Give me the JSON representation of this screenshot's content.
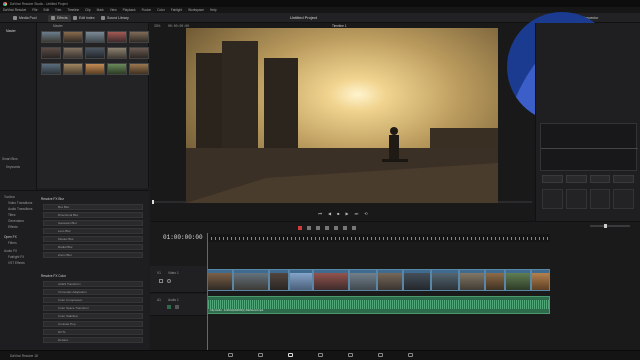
{
  "window": {
    "title": "DaVinci Resolve Studio - Untitled Project"
  },
  "menu": [
    "DaVinci Resolve",
    "File",
    "Edit",
    "Trim",
    "Timeline",
    "Clip",
    "Mark",
    "View",
    "Playback",
    "Fusion",
    "Color",
    "Fairlight",
    "Workspace",
    "Help"
  ],
  "toolbar": {
    "media_pool": "Media Pool",
    "effects": "Effects",
    "edit_index": "Edit Index",
    "sound_library": "Sound Library",
    "inspector": "Inspector",
    "project_title": "Untitled Project",
    "timeline_name": "Timeline 1",
    "zoom": "33%",
    "source_tc": "00:00:00:00"
  },
  "media": {
    "bin_label": "Master",
    "smart_bins": "Smart Bins",
    "keywords": "Keywords"
  },
  "effects": {
    "sections": [
      "Toolbox",
      "Video Transitions",
      "Audio Transitions",
      "Titles",
      "Generators",
      "Effects",
      "Open FX",
      "Filters",
      "Audio FX",
      "Fairlight FX",
      "VST Effects"
    ],
    "group1": "Resolve FX Blur",
    "group1_items": [
      "Box Blur",
      "Directional Blur",
      "Gaussian Blur",
      "Lens Blur",
      "Mosaic Blur",
      "Radial Blur",
      "Zoom Blur"
    ],
    "group2": "Resolve FX Color",
    "group2_items": [
      "ACES Transform",
      "Chromatic Adaptation",
      "Color Compressor",
      "Color Space Transform",
      "Color Stabilizer",
      "Contrast Pop",
      "DCTL",
      "Dehaze"
    ],
    "favorites": "Favorites"
  },
  "timeline": {
    "timecode": "01:00:00:00",
    "video_track": {
      "id": "V1",
      "name": "Video 1"
    },
    "audio_track": {
      "id": "A1",
      "name": "Audio 1"
    },
    "audio_clip_label": "Clip Audio - lmdSn0p0wK8h(1).RatSound.mp4"
  },
  "footer": {
    "app": "DaVinci Resolve 18"
  },
  "colors": {
    "accent": "#d23b3b",
    "video_clip": "#3f6c8e",
    "audio_clip": "#2e6a4c",
    "panel": "#1e1e20"
  },
  "icons": [
    "media-pool-icon",
    "effects-icon",
    "edit-index-icon",
    "sound-library-icon",
    "inspector-icon",
    "play-icon",
    "stop-icon",
    "loop-icon",
    "media-page-icon",
    "cut-page-icon",
    "edit-page-icon",
    "fusion-page-icon",
    "color-page-icon",
    "fairlight-page-icon",
    "deliver-page-icon"
  ]
}
